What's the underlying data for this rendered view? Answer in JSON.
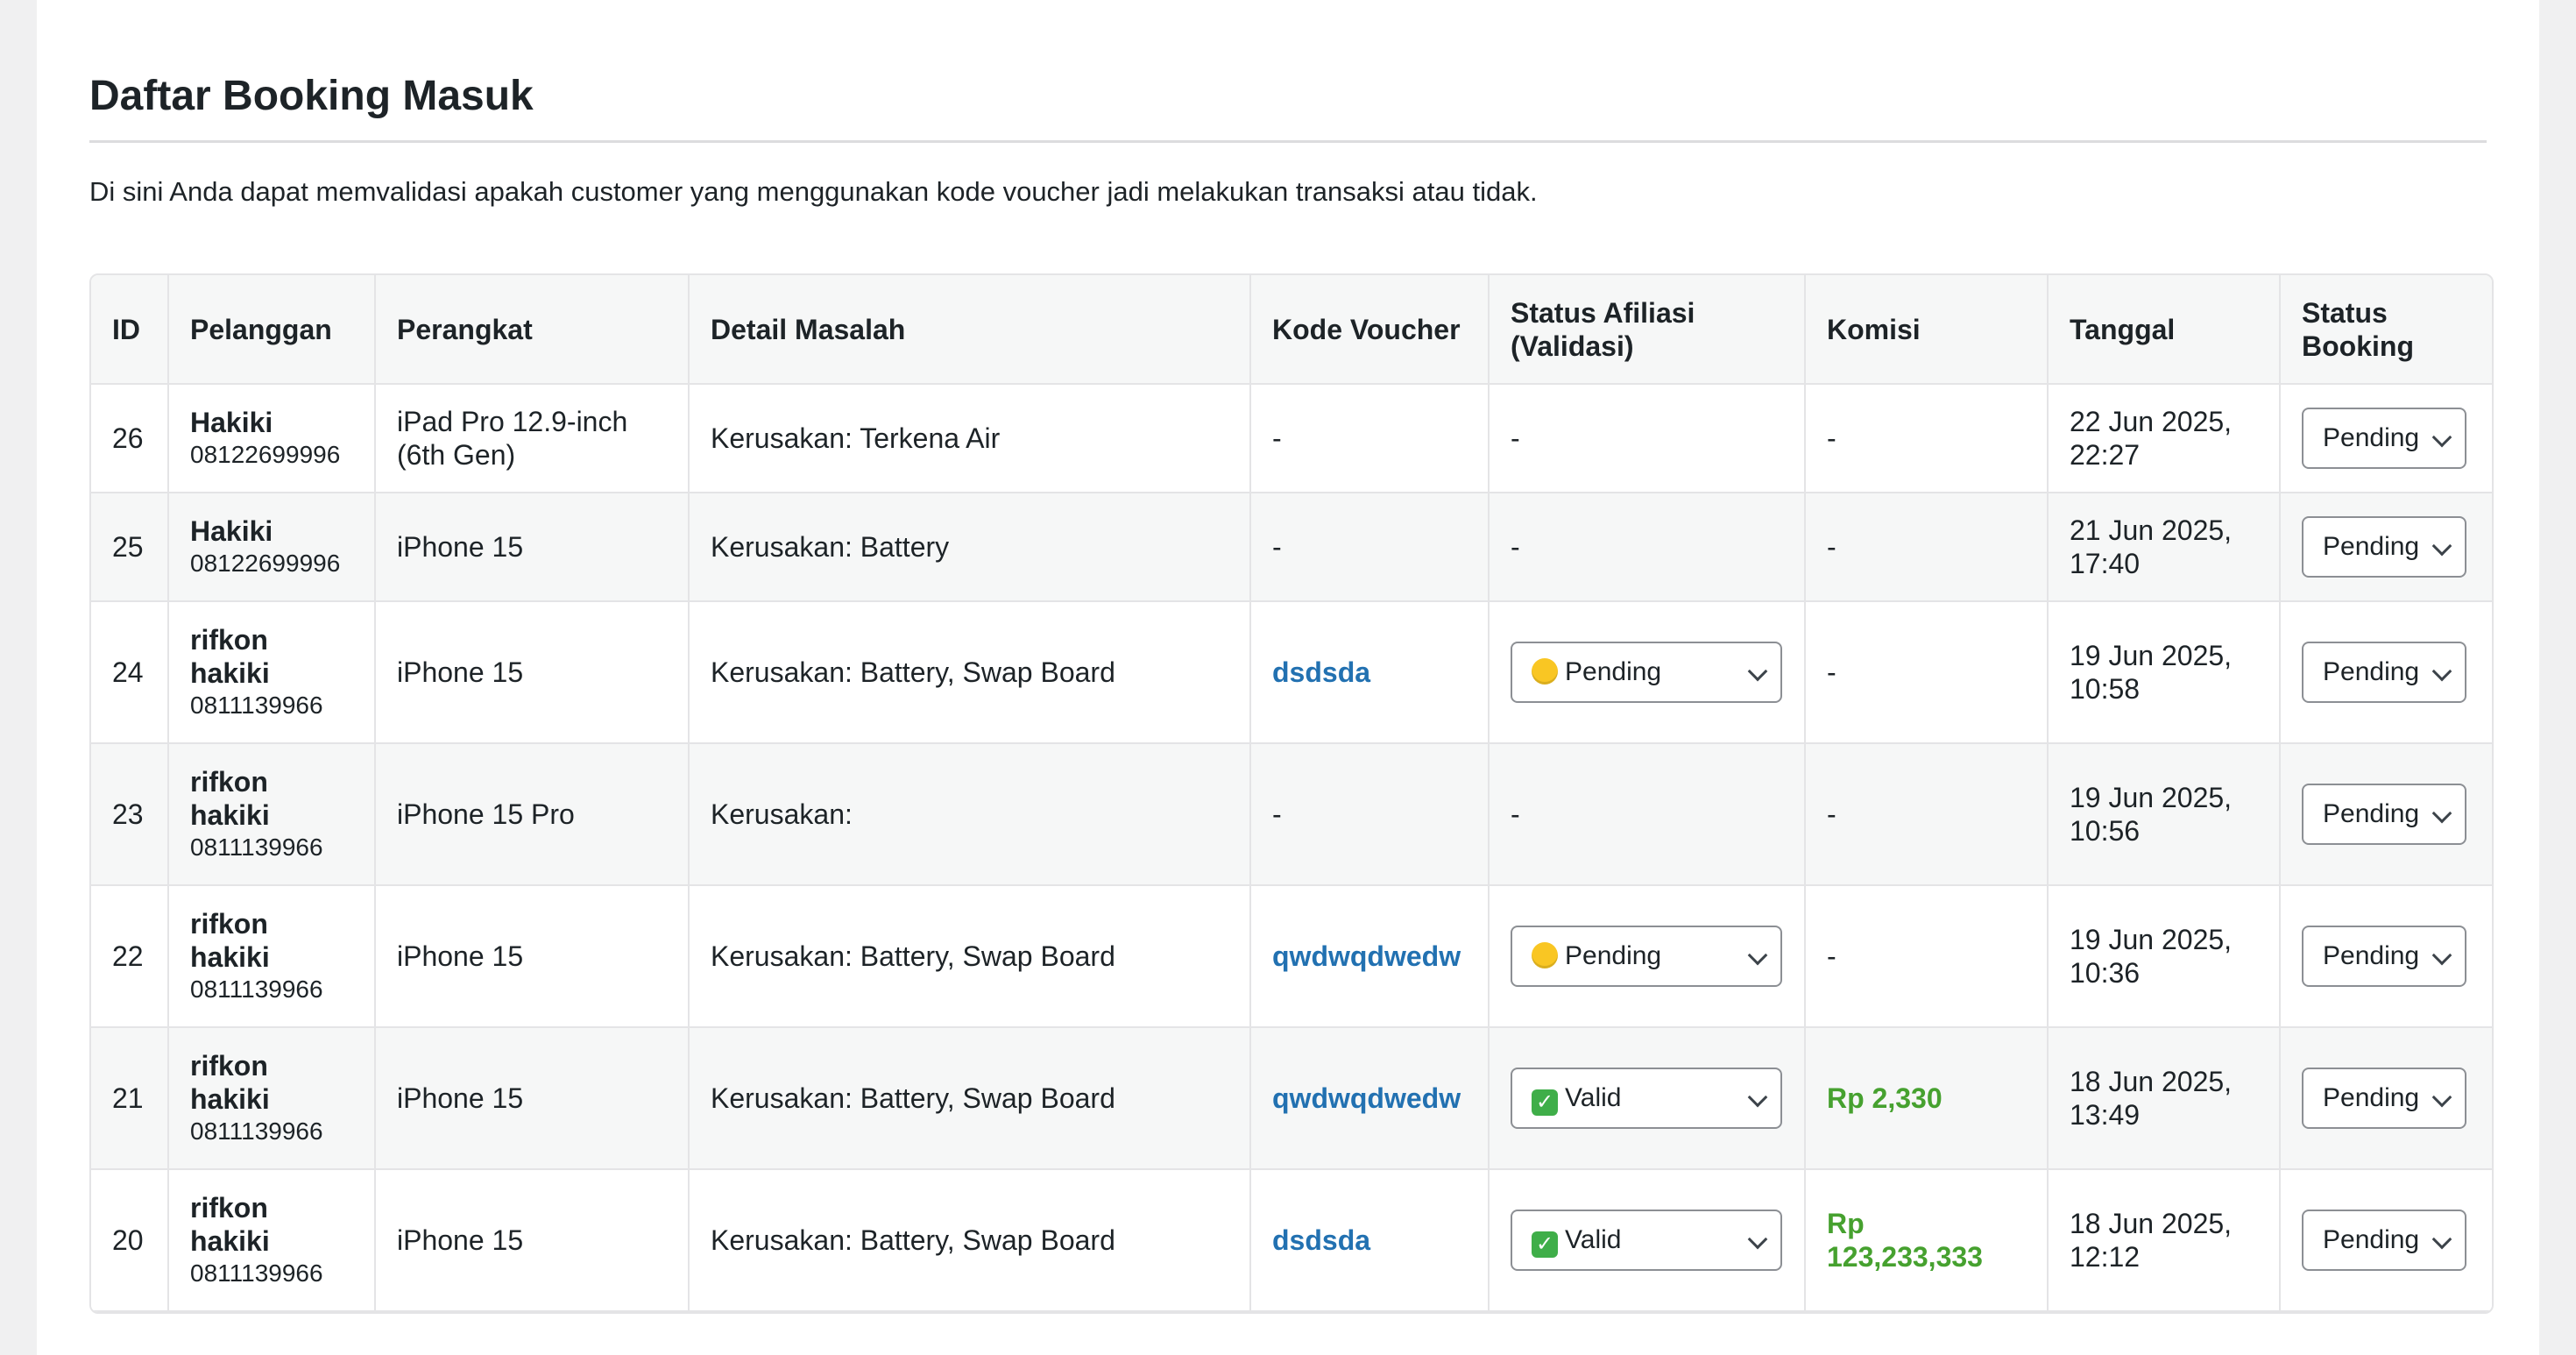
{
  "page": {
    "title": "Daftar Booking Masuk",
    "description": "Di sini Anda dapat memvalidasi apakah customer yang menggunakan kode voucher jadi melakukan transaksi atau tidak."
  },
  "table": {
    "headers": {
      "id": "ID",
      "pelanggan": "Pelanggan",
      "perangkat": "Perangkat",
      "detail": "Detail Masalah",
      "kode_voucher": "Kode Voucher",
      "status_afiliasi": "Status Afiliasi (Validasi)",
      "komisi": "Komisi",
      "tanggal": "Tanggal",
      "status_booking": "Status Booking"
    },
    "rows": [
      {
        "id": "26",
        "name": "Hakiki",
        "phone": "08122699996",
        "device": "iPad Pro 12.9-inch (6th Gen)",
        "detail": "Kerusakan: Terkena Air",
        "voucher": "-",
        "affiliate_status": "-",
        "commission": "-",
        "date": "22 Jun 2025, 22:27",
        "booking_status": "Pending"
      },
      {
        "id": "25",
        "name": "Hakiki",
        "phone": "08122699996",
        "device": "iPhone 15",
        "detail": "Kerusakan: Battery",
        "voucher": "-",
        "affiliate_status": "-",
        "commission": "-",
        "date": "21 Jun 2025, 17:40",
        "booking_status": "Pending"
      },
      {
        "id": "24",
        "name": "rifkon hakiki",
        "phone": "0811139966",
        "device": "iPhone 15",
        "detail": "Kerusakan: Battery, Swap Board",
        "voucher": "dsdsda",
        "affiliate_status": "Pending",
        "affiliate_icon": "pending-dot-icon",
        "commission": "-",
        "date": "19 Jun 2025, 10:58",
        "booking_status": "Pending"
      },
      {
        "id": "23",
        "name": "rifkon hakiki",
        "phone": "0811139966",
        "device": "iPhone 15 Pro",
        "detail": "Kerusakan:",
        "voucher": "-",
        "affiliate_status": "-",
        "commission": "-",
        "date": "19 Jun 2025, 10:56",
        "booking_status": "Pending"
      },
      {
        "id": "22",
        "name": "rifkon hakiki",
        "phone": "0811139966",
        "device": "iPhone 15",
        "detail": "Kerusakan: Battery, Swap Board",
        "voucher": "qwdwqdwedw",
        "affiliate_status": "Pending",
        "affiliate_icon": "pending-dot-icon",
        "commission": "-",
        "date": "19 Jun 2025, 10:36",
        "booking_status": "Pending"
      },
      {
        "id": "21",
        "name": "rifkon hakiki",
        "phone": "0811139966",
        "device": "iPhone 15",
        "detail": "Kerusakan: Battery, Swap Board",
        "voucher": "qwdwqdwedw",
        "affiliate_status": "Valid",
        "affiliate_icon": "check-icon",
        "commission": "Rp 2,330",
        "date": "18 Jun 2025, 13:49",
        "booking_status": "Pending"
      },
      {
        "id": "20",
        "name": "rifkon hakiki",
        "phone": "0811139966",
        "device": "iPhone 15",
        "detail": "Kerusakan: Battery, Swap Board",
        "voucher": "dsdsda",
        "affiliate_status": "Valid",
        "affiliate_icon": "check-icon",
        "commission": "Rp 123,233,333",
        "date": "18 Jun 2025, 12:12",
        "booking_status": "Pending"
      }
    ]
  },
  "colors": {
    "voucher_link": "#2271b1",
    "commission": "#46a12f",
    "pending_dot": "#f9c623",
    "valid_check": "#3fae49"
  }
}
